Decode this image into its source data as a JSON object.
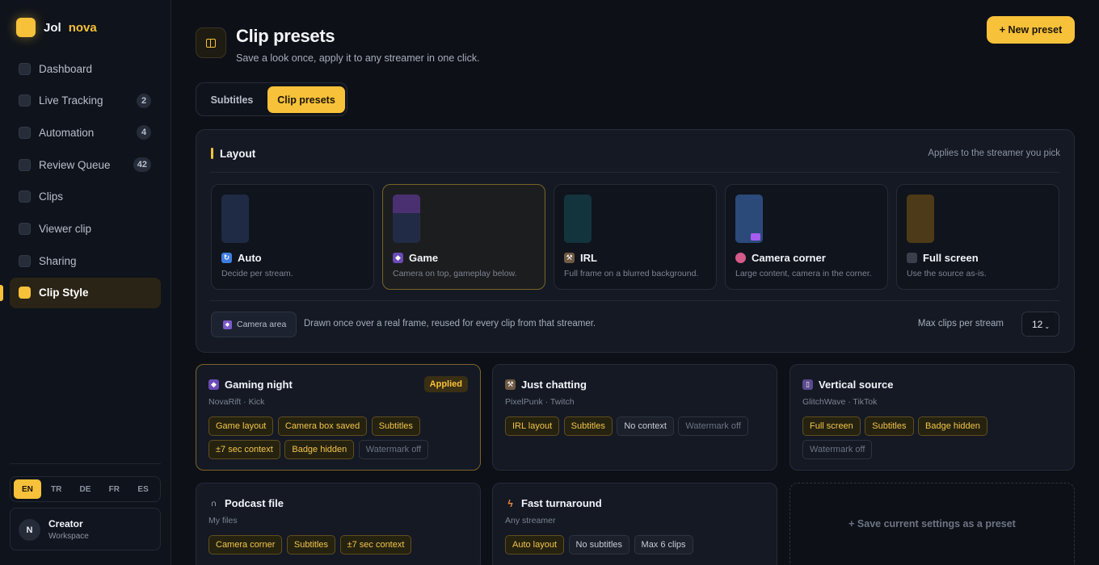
{
  "brand": {
    "name_part1": "Jol",
    "name_part2": "nova"
  },
  "sidebar": {
    "items": [
      {
        "label": "Dashboard",
        "count": null
      },
      {
        "label": "Live Tracking",
        "count": "2"
      },
      {
        "label": "Automation",
        "count": "4"
      },
      {
        "label": "Review Queue",
        "count": "42"
      },
      {
        "label": "Clips",
        "count": null
      },
      {
        "label": "Viewer clip",
        "count": null
      },
      {
        "label": "Sharing",
        "count": null
      },
      {
        "label": "Clip Style",
        "count": null,
        "active": true
      }
    ],
    "languages": [
      "EN",
      "TR",
      "DE",
      "FR",
      "ES"
    ],
    "active_language": "EN",
    "user": {
      "initial": "N",
      "name": "Creator",
      "role": "Workspace"
    }
  },
  "header": {
    "title": "Clip presets",
    "subtitle": "Save a look once, apply it to any streamer in one click.",
    "new_preset": "+ New preset"
  },
  "tabs": [
    {
      "label": "Subtitles",
      "active": false
    },
    {
      "label": "Clip presets",
      "active": true
    }
  ],
  "layout": {
    "title": "Layout",
    "hint": "Applies to the streamer you pick",
    "options": [
      {
        "title": "Auto",
        "desc": "Decide per stream.",
        "icon": "auto-icon",
        "selected": false
      },
      {
        "title": "Game",
        "desc": "Camera on top, gameplay below.",
        "icon": "gamepad-icon",
        "selected": true
      },
      {
        "title": "IRL",
        "desc": "Full frame on a blurred background.",
        "icon": "pickaxe-icon",
        "selected": false
      },
      {
        "title": "Camera corner",
        "desc": "Large content, camera in the corner.",
        "icon": "brain-icon",
        "selected": false
      },
      {
        "title": "Full screen",
        "desc": "Use the source as-is.",
        "icon": "square-icon",
        "selected": false
      }
    ],
    "camera_area": {
      "label": "Camera area",
      "desc": "Drawn once over a real frame, reused for every clip from that streamer."
    },
    "max_clips": {
      "label": "Max clips per stream",
      "value": "12"
    }
  },
  "presets": [
    {
      "title": "Gaming night",
      "icon": "gamepad-icon",
      "subtitle": "NovaRift · Kick",
      "applied_label": "Applied",
      "tags": [
        {
          "label": "Game layout",
          "kind": "on"
        },
        {
          "label": "Camera box saved",
          "kind": "on"
        },
        {
          "label": "Subtitles",
          "kind": "on"
        },
        {
          "label": "±7 sec context",
          "kind": "on"
        },
        {
          "label": "Badge hidden",
          "kind": "on"
        },
        {
          "label": "Watermark off",
          "kind": "off"
        }
      ]
    },
    {
      "title": "Just chatting",
      "icon": "pickaxe-icon",
      "subtitle": "PixelPunk · Twitch",
      "tags": [
        {
          "label": "IRL layout",
          "kind": "on"
        },
        {
          "label": "Subtitles",
          "kind": "on"
        },
        {
          "label": "No context",
          "kind": "neutral"
        },
        {
          "label": "Watermark off",
          "kind": "off"
        }
      ]
    },
    {
      "title": "Vertical source",
      "icon": "phone-icon",
      "subtitle": "GlitchWave · TikTok",
      "tags": [
        {
          "label": "Full screen",
          "kind": "on"
        },
        {
          "label": "Subtitles",
          "kind": "on"
        },
        {
          "label": "Badge hidden",
          "kind": "on"
        },
        {
          "label": "Watermark off",
          "kind": "off"
        }
      ]
    },
    {
      "title": "Podcast file",
      "icon": "headphones-icon",
      "subtitle": "My files",
      "tags": [
        {
          "label": "Camera corner",
          "kind": "on"
        },
        {
          "label": "Subtitles",
          "kind": "on"
        },
        {
          "label": "±7 sec context",
          "kind": "on"
        }
      ]
    },
    {
      "title": "Fast turnaround",
      "icon": "lightning-icon",
      "subtitle": "Any streamer",
      "tags": [
        {
          "label": "Auto layout",
          "kind": "on"
        },
        {
          "label": "No subtitles",
          "kind": "neutral"
        },
        {
          "label": "Max 6 clips",
          "kind": "neutral"
        }
      ]
    }
  ],
  "save_preset": "+ Save current settings as a preset",
  "colors": {
    "accent": "#f7c13a",
    "background": "#0d1017",
    "card": "#141924"
  }
}
